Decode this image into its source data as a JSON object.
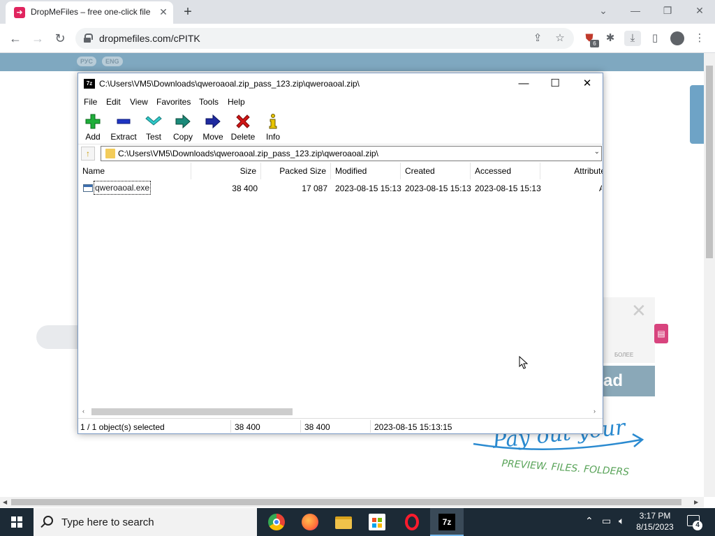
{
  "browser": {
    "tab_title": "DropMeFiles – free one-click file",
    "url": "dropmefiles.com/cPITK",
    "extension_badge": "6"
  },
  "site": {
    "lang_ru": "РУС",
    "lang_en": "ENG",
    "download_partial": "ad",
    "ad_more": "БОЛЕЕ",
    "handwriting_line1": "Pay out your",
    "handwriting_line2": "PREVIEW. FILES. FOLDERS"
  },
  "zip": {
    "title": "C:\\Users\\VM5\\Downloads\\qweroaoal.zip_pass_123.zip\\qweroaoal.zip\\",
    "menu": [
      "File",
      "Edit",
      "View",
      "Favorites",
      "Tools",
      "Help"
    ],
    "toolbar": [
      {
        "label": "Add",
        "icon": "plus-icon",
        "color": "#1fae3a"
      },
      {
        "label": "Extract",
        "icon": "minus-icon",
        "color": "#1f35c4"
      },
      {
        "label": "Test",
        "icon": "check-icon",
        "color": "#2fc8c8"
      },
      {
        "label": "Copy",
        "icon": "copy-arrow-icon",
        "color": "#1b8a7a"
      },
      {
        "label": "Move",
        "icon": "move-arrow-icon",
        "color": "#1f2aa0"
      },
      {
        "label": "Delete",
        "icon": "delete-x-icon",
        "color": "#d01515"
      },
      {
        "label": "Info",
        "icon": "info-icon",
        "color": "#b89a00"
      }
    ],
    "address": "C:\\Users\\VM5\\Downloads\\qweroaoal.zip_pass_123.zip\\qweroaoal.zip\\",
    "columns": [
      "Name",
      "Size",
      "Packed Size",
      "Modified",
      "Created",
      "Accessed",
      "Attribute"
    ],
    "rows": [
      {
        "name": "qweroaoal.exe",
        "size": "38 400",
        "packed": "17 087",
        "modified": "2023-08-15 15:13",
        "created": "2023-08-15 15:13",
        "accessed": "2023-08-15 15:13",
        "attribute": "A"
      }
    ],
    "status": {
      "selected": "1 / 1 object(s) selected",
      "size": "38 400",
      "packed": "38 400",
      "modified": "2023-08-15 15:13:15"
    }
  },
  "taskbar": {
    "search_placeholder": "Type here to search",
    "time": "3:17 PM",
    "date": "8/15/2023",
    "notifications": "4",
    "zip_app_label": "7z"
  }
}
